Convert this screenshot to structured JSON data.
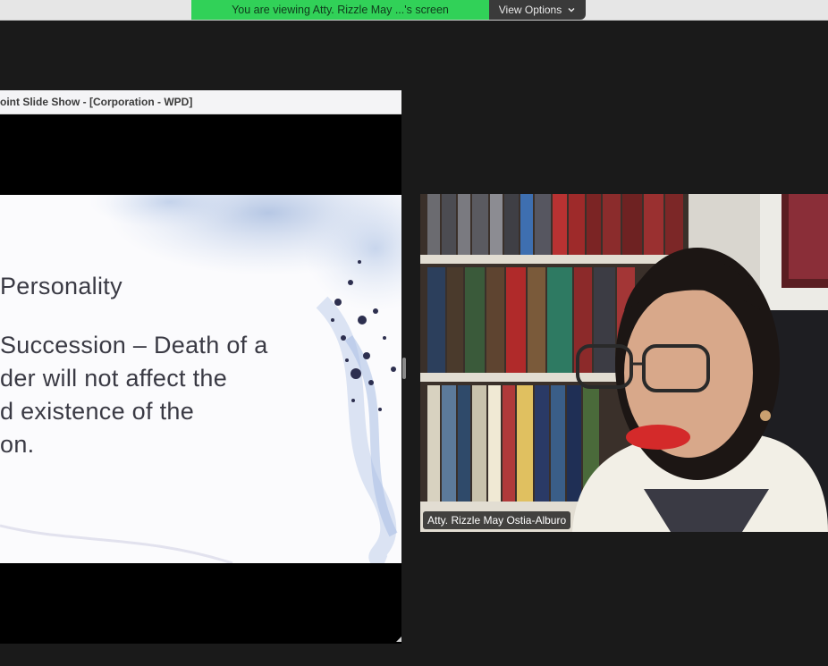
{
  "banner": {
    "viewing_text": "You are viewing Atty. Rizzle May ...'s screen",
    "view_options_label": "View Options"
  },
  "shared_window": {
    "title": "oint Slide Show - [Corporation - WPD]"
  },
  "slide": {
    "heading": "Personality",
    "lines": [
      "Succession – Death of a",
      "der will not affect the",
      "d existence of the",
      "on."
    ]
  },
  "participant": {
    "name": "Atty. Rizzle May Ostia-Alburo"
  },
  "colors": {
    "banner_green": "#31d158",
    "background": "#1a1a1a"
  }
}
